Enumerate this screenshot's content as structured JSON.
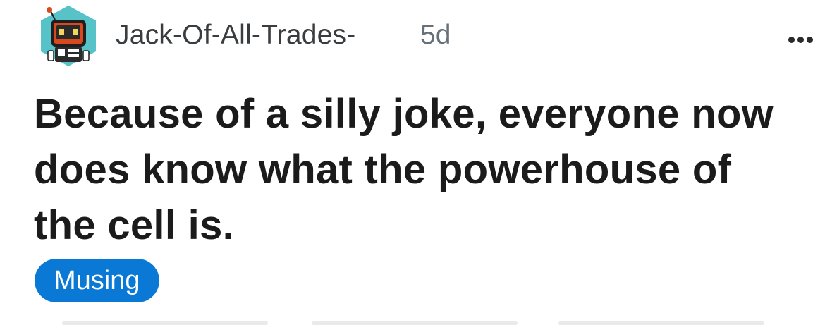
{
  "post": {
    "author": "Jack-Of-All-Trades-",
    "age": "5d",
    "title": "Because of a silly joke, everyone now does know what the powerhouse of the cell is.",
    "flair": "Musing",
    "flair_color": "#0a79d6",
    "avatar_icon": "robot-avatar-icon",
    "more_icon": "more-options-icon"
  }
}
